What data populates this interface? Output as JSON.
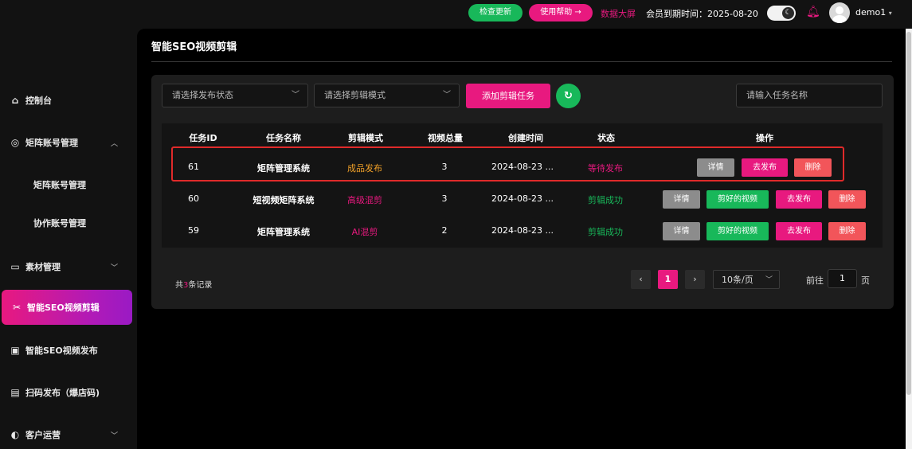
{
  "topbar": {
    "check_update": "检查更新",
    "help": "使用帮助 →",
    "data_screen": "数据大屏",
    "member_expiry": "会员到期时间：2025-08-20",
    "username": "demo1",
    "username_caret": "▾",
    "theme_icon": "moon-icon",
    "bell_icon": "bell-icon"
  },
  "sidebar": {
    "items": [
      {
        "label": "控制台",
        "icon": "home-icon"
      },
      {
        "label": "矩阵账号管理",
        "icon": "gauge-icon",
        "chevron": "︿"
      },
      {
        "label": "矩阵账号管理"
      },
      {
        "label": "协作账号管理"
      },
      {
        "label": "素材管理",
        "icon": "folder-icon",
        "chevron": "﹀"
      },
      {
        "label": "智能SEO视频剪辑",
        "icon": "scissors-icon"
      },
      {
        "label": "智能SEO视频发布",
        "icon": "video-icon"
      },
      {
        "label": "扫码发布（爆店码)",
        "icon": "qr-icon"
      },
      {
        "label": "客户运营",
        "icon": "customer-icon",
        "chevron": "﹀"
      }
    ],
    "active_index": 5
  },
  "page": {
    "title": "智能SEO视频剪辑"
  },
  "filters": {
    "publish_status_placeholder": "请选择发布状态",
    "edit_mode_placeholder": "请选择剪辑模式",
    "add_task": "添加剪辑任务",
    "refresh_icon": "refresh-icon",
    "search_placeholder": "请输入任务名称"
  },
  "table": {
    "headers": [
      "任务ID",
      "任务名称",
      "剪辑模式",
      "视频总量",
      "创建时间",
      "状态",
      "操作"
    ],
    "rows": [
      {
        "id": "61",
        "name": "矩阵管理系统",
        "mode": "成品发布",
        "total": "3",
        "created": "2024-08-23 ...",
        "status": "等待发布",
        "ops": {
          "detail": "详情",
          "publish": "去发布",
          "delete": "删除"
        }
      },
      {
        "id": "60",
        "name": "短视频矩阵系统",
        "mode": "高级混剪",
        "total": "3",
        "created": "2024-08-23 ...",
        "status": "剪辑成功",
        "ops": {
          "detail": "详情",
          "cut_video": "剪好的视频",
          "publish": "去发布",
          "delete": "删除"
        }
      },
      {
        "id": "59",
        "name": "矩阵管理系统",
        "mode": "AI混剪",
        "total": "2",
        "created": "2024-08-23 ...",
        "status": "剪辑成功",
        "ops": {
          "detail": "详情",
          "cut_video": "剪好的视频",
          "publish": "去发布",
          "delete": "删除"
        }
      }
    ]
  },
  "pagination": {
    "total_prefix": "共",
    "total_count": "3",
    "total_suffix": "条记录",
    "current_page": "1",
    "page_size": "10条/页",
    "goto_label": "前往",
    "goto_value": "1",
    "goto_unit": "页"
  },
  "colors": {
    "accent_pink": "#e8197f",
    "success_green": "#18b85a",
    "warning_orange": "#f0a028",
    "danger_red": "#f2555a",
    "highlight_border": "#e02a2a"
  }
}
